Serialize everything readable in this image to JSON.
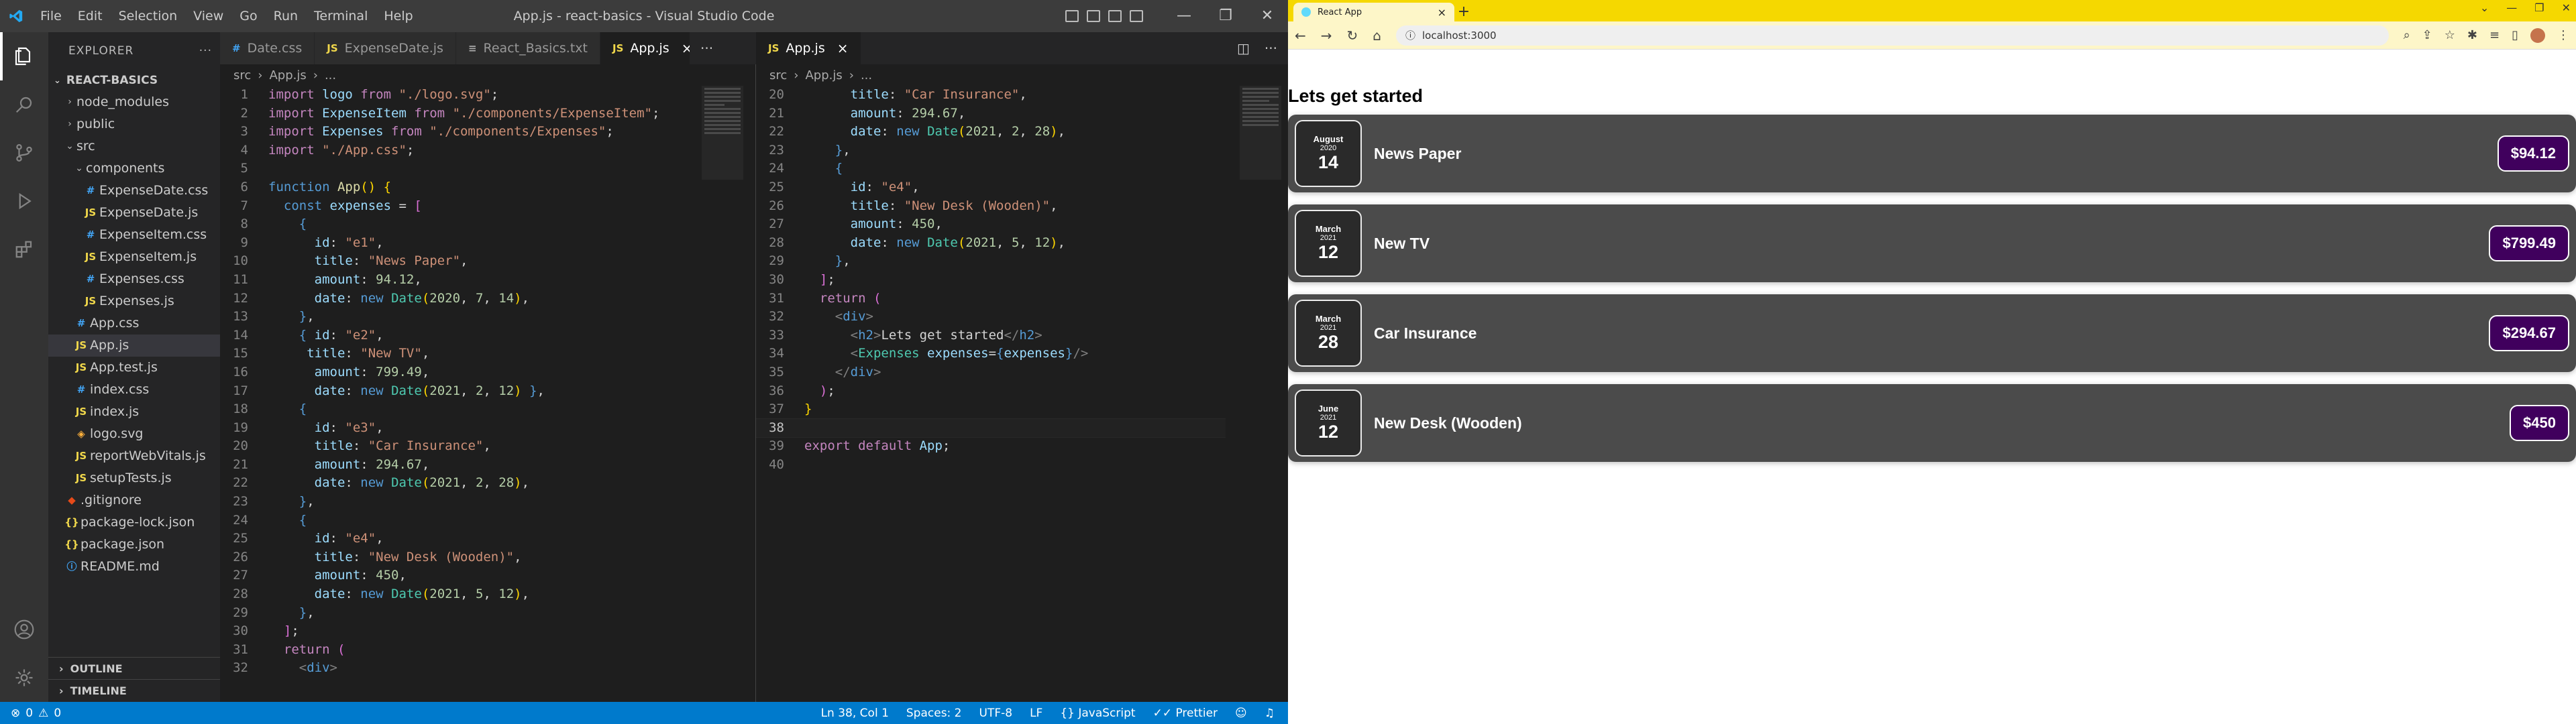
{
  "vscode": {
    "title": "App.js - react-basics - Visual Studio Code",
    "menu": [
      "File",
      "Edit",
      "Selection",
      "View",
      "Go",
      "Run",
      "Terminal",
      "Help"
    ],
    "sidebar": {
      "title": "EXPLORER",
      "project": "REACT-BASICS",
      "items": [
        {
          "label": "node_modules",
          "type": "folder",
          "depth": 1,
          "open": false
        },
        {
          "label": "public",
          "type": "folder",
          "depth": 1,
          "open": false
        },
        {
          "label": "src",
          "type": "folder",
          "depth": 1,
          "open": true
        },
        {
          "label": "components",
          "type": "folder",
          "depth": 2,
          "open": true
        },
        {
          "label": "ExpenseDate.css",
          "type": "css",
          "depth": 3
        },
        {
          "label": "ExpenseDate.js",
          "type": "js",
          "depth": 3
        },
        {
          "label": "ExpenseItem.css",
          "type": "css",
          "depth": 3
        },
        {
          "label": "ExpenseItem.js",
          "type": "js",
          "depth": 3
        },
        {
          "label": "Expenses.css",
          "type": "css",
          "depth": 3
        },
        {
          "label": "Expenses.js",
          "type": "js",
          "depth": 3
        },
        {
          "label": "App.css",
          "type": "css",
          "depth": 2
        },
        {
          "label": "App.js",
          "type": "js",
          "depth": 2,
          "selected": true
        },
        {
          "label": "App.test.js",
          "type": "js",
          "depth": 2
        },
        {
          "label": "index.css",
          "type": "css",
          "depth": 2
        },
        {
          "label": "index.js",
          "type": "js",
          "depth": 2
        },
        {
          "label": "logo.svg",
          "type": "svg",
          "depth": 2
        },
        {
          "label": "reportWebVitals.js",
          "type": "js",
          "depth": 2
        },
        {
          "label": "setupTests.js",
          "type": "js",
          "depth": 2
        },
        {
          "label": ".gitignore",
          "type": "git",
          "depth": 1
        },
        {
          "label": "package-lock.json",
          "type": "json",
          "depth": 1
        },
        {
          "label": "package.json",
          "type": "json",
          "depth": 1
        },
        {
          "label": "README.md",
          "type": "md",
          "depth": 1
        }
      ],
      "outline": "OUTLINE",
      "timeline": "TIMELINE"
    },
    "left_tabs": [
      {
        "label": "Date.css",
        "icon": "css",
        "active": false
      },
      {
        "label": "ExpenseDate.js",
        "icon": "js",
        "active": false
      },
      {
        "label": "React_Basics.txt",
        "icon": "txt",
        "active": false
      },
      {
        "label": "App.js",
        "icon": "js",
        "active": true
      }
    ],
    "right_tabs": [
      {
        "label": "App.js",
        "icon": "js",
        "active": true
      }
    ],
    "breadcrumb": [
      "src",
      "App.js",
      "..."
    ],
    "left_start_line": 1,
    "right_start_line": 20,
    "current_line": 38,
    "code": [
      [
        [
          "k",
          "import "
        ],
        [
          "t",
          "logo "
        ],
        [
          "k",
          "from "
        ],
        [
          "s",
          "\"./logo.svg\""
        ],
        [
          "p",
          ";"
        ]
      ],
      [
        [
          "k",
          "import "
        ],
        [
          "t",
          "ExpenseItem "
        ],
        [
          "k",
          "from "
        ],
        [
          "s",
          "\"./components/ExpenseItem\""
        ],
        [
          "p",
          ";"
        ]
      ],
      [
        [
          "k",
          "import "
        ],
        [
          "t",
          "Expenses "
        ],
        [
          "k",
          "from "
        ],
        [
          "s",
          "\"./components/Expenses\""
        ],
        [
          "p",
          ";"
        ]
      ],
      [
        [
          "k",
          "import "
        ],
        [
          "s",
          "\"./App.css\""
        ],
        [
          "p",
          ";"
        ]
      ],
      [],
      [
        [
          "b",
          "function "
        ],
        [
          "f",
          "App"
        ],
        [
          "y",
          "() {"
        ]
      ],
      [
        [
          "p",
          "  "
        ],
        [
          "b",
          "const "
        ],
        [
          "t",
          "expenses "
        ],
        [
          "p",
          "= "
        ],
        [
          "m",
          "["
        ]
      ],
      [
        [
          "p",
          "    "
        ],
        [
          "b",
          "{"
        ]
      ],
      [
        [
          "p",
          "      "
        ],
        [
          "t",
          "id"
        ],
        [
          "p",
          ": "
        ],
        [
          "s",
          "\"e1\""
        ],
        [
          "p",
          ","
        ]
      ],
      [
        [
          "p",
          "      "
        ],
        [
          "t",
          "title"
        ],
        [
          "p",
          ": "
        ],
        [
          "s",
          "\"News Paper\""
        ],
        [
          "p",
          ","
        ]
      ],
      [
        [
          "p",
          "      "
        ],
        [
          "t",
          "amount"
        ],
        [
          "p",
          ": "
        ],
        [
          "n",
          "94.12"
        ],
        [
          "p",
          ","
        ]
      ],
      [
        [
          "p",
          "      "
        ],
        [
          "t",
          "date"
        ],
        [
          "p",
          ": "
        ],
        [
          "b",
          "new "
        ],
        [
          "c",
          "Date"
        ],
        [
          "y",
          "("
        ],
        [
          "n",
          "2020"
        ],
        [
          "p",
          ", "
        ],
        [
          "n",
          "7"
        ],
        [
          "p",
          ", "
        ],
        [
          "n",
          "14"
        ],
        [
          "y",
          ")"
        ],
        [
          "p",
          ","
        ]
      ],
      [
        [
          "p",
          "    "
        ],
        [
          "b",
          "}"
        ],
        [
          "p",
          ","
        ]
      ],
      [
        [
          "p",
          "    "
        ],
        [
          "b",
          "{ "
        ],
        [
          "t",
          "id"
        ],
        [
          "p",
          ": "
        ],
        [
          "s",
          "\"e2\""
        ],
        [
          "p",
          ","
        ]
      ],
      [
        [
          "p",
          "     "
        ],
        [
          "t",
          "title"
        ],
        [
          "p",
          ": "
        ],
        [
          "s",
          "\"New TV\""
        ],
        [
          "p",
          ","
        ]
      ],
      [
        [
          "p",
          "      "
        ],
        [
          "t",
          "amount"
        ],
        [
          "p",
          ": "
        ],
        [
          "n",
          "799.49"
        ],
        [
          "p",
          ","
        ]
      ],
      [
        [
          "p",
          "      "
        ],
        [
          "t",
          "date"
        ],
        [
          "p",
          ": "
        ],
        [
          "b",
          "new "
        ],
        [
          "c",
          "Date"
        ],
        [
          "y",
          "("
        ],
        [
          "n",
          "2021"
        ],
        [
          "p",
          ", "
        ],
        [
          "n",
          "2"
        ],
        [
          "p",
          ", "
        ],
        [
          "n",
          "12"
        ],
        [
          "y",
          ")"
        ],
        [
          "b",
          " }"
        ],
        [
          "p",
          ","
        ]
      ],
      [
        [
          "p",
          "    "
        ],
        [
          "b",
          "{"
        ]
      ],
      [
        [
          "p",
          "      "
        ],
        [
          "t",
          "id"
        ],
        [
          "p",
          ": "
        ],
        [
          "s",
          "\"e3\""
        ],
        [
          "p",
          ","
        ]
      ],
      [
        [
          "p",
          "      "
        ],
        [
          "t",
          "title"
        ],
        [
          "p",
          ": "
        ],
        [
          "s",
          "\"Car Insurance\""
        ],
        [
          "p",
          ","
        ]
      ],
      [
        [
          "p",
          "      "
        ],
        [
          "t",
          "amount"
        ],
        [
          "p",
          ": "
        ],
        [
          "n",
          "294.67"
        ],
        [
          "p",
          ","
        ]
      ],
      [
        [
          "p",
          "      "
        ],
        [
          "t",
          "date"
        ],
        [
          "p",
          ": "
        ],
        [
          "b",
          "new "
        ],
        [
          "c",
          "Date"
        ],
        [
          "y",
          "("
        ],
        [
          "n",
          "2021"
        ],
        [
          "p",
          ", "
        ],
        [
          "n",
          "2"
        ],
        [
          "p",
          ", "
        ],
        [
          "n",
          "28"
        ],
        [
          "y",
          ")"
        ],
        [
          "p",
          ","
        ]
      ],
      [
        [
          "p",
          "    "
        ],
        [
          "b",
          "}"
        ],
        [
          "p",
          ","
        ]
      ],
      [
        [
          "p",
          "    "
        ],
        [
          "b",
          "{"
        ]
      ],
      [
        [
          "p",
          "      "
        ],
        [
          "t",
          "id"
        ],
        [
          "p",
          ": "
        ],
        [
          "s",
          "\"e4\""
        ],
        [
          "p",
          ","
        ]
      ],
      [
        [
          "p",
          "      "
        ],
        [
          "t",
          "title"
        ],
        [
          "p",
          ": "
        ],
        [
          "s",
          "\"New Desk (Wooden)\""
        ],
        [
          "p",
          ","
        ]
      ],
      [
        [
          "p",
          "      "
        ],
        [
          "t",
          "amount"
        ],
        [
          "p",
          ": "
        ],
        [
          "n",
          "450"
        ],
        [
          "p",
          ","
        ]
      ],
      [
        [
          "p",
          "      "
        ],
        [
          "t",
          "date"
        ],
        [
          "p",
          ": "
        ],
        [
          "b",
          "new "
        ],
        [
          "c",
          "Date"
        ],
        [
          "y",
          "("
        ],
        [
          "n",
          "2021"
        ],
        [
          "p",
          ", "
        ],
        [
          "n",
          "5"
        ],
        [
          "p",
          ", "
        ],
        [
          "n",
          "12"
        ],
        [
          "y",
          ")"
        ],
        [
          "p",
          ","
        ]
      ],
      [
        [
          "p",
          "    "
        ],
        [
          "b",
          "}"
        ],
        [
          "p",
          ","
        ]
      ],
      [
        [
          "p",
          "  "
        ],
        [
          "m",
          "]"
        ],
        [
          "p",
          ";"
        ]
      ],
      [
        [
          "p",
          "  "
        ],
        [
          "k",
          "return "
        ],
        [
          "m",
          "("
        ]
      ],
      [
        [
          "p",
          "    "
        ],
        [
          "g",
          "<"
        ],
        [
          "b",
          "div"
        ],
        [
          "g",
          ">"
        ]
      ],
      [
        [
          "p",
          "      "
        ],
        [
          "g",
          "<"
        ],
        [
          "b",
          "h2"
        ],
        [
          "g",
          ">"
        ],
        [
          "p",
          "Lets get started"
        ],
        [
          "g",
          "</"
        ],
        [
          "b",
          "h2"
        ],
        [
          "g",
          ">"
        ]
      ],
      [
        [
          "p",
          "      "
        ],
        [
          "g",
          "<"
        ],
        [
          "c",
          "Expenses "
        ],
        [
          "t",
          "expenses"
        ],
        [
          "p",
          "="
        ],
        [
          "b",
          "{"
        ],
        [
          "t",
          "expenses"
        ],
        [
          "b",
          "}"
        ],
        [
          "g",
          "/>"
        ]
      ],
      [
        [
          "p",
          "    "
        ],
        [
          "g",
          "</"
        ],
        [
          "b",
          "div"
        ],
        [
          "g",
          ">"
        ]
      ],
      [
        [
          "p",
          "  "
        ],
        [
          "m",
          ")"
        ],
        [
          "p",
          ";"
        ]
      ],
      [
        [
          "y",
          "}"
        ]
      ],
      [],
      [
        [
          "k",
          "export "
        ],
        [
          "k",
          "default "
        ],
        [
          "t",
          "App"
        ],
        [
          "p",
          ";"
        ]
      ],
      []
    ],
    "status": {
      "errors": "0",
      "warnings": "0",
      "position": "Ln 38, Col 1",
      "spaces": "Spaces: 2",
      "encoding": "UTF-8",
      "eol": "LF",
      "language": "JavaScript",
      "formatter": "Prettier"
    }
  },
  "browser": {
    "tab_title": "React App",
    "url": "localhost:3000",
    "heading": "Lets get started",
    "expenses": [
      {
        "month": "August",
        "year": "2020",
        "day": "14",
        "title": "News Paper",
        "price": "$94.12"
      },
      {
        "month": "March",
        "year": "2021",
        "day": "12",
        "title": "New TV",
        "price": "$799.49"
      },
      {
        "month": "March",
        "year": "2021",
        "day": "28",
        "title": "Car Insurance",
        "price": "$294.67"
      },
      {
        "month": "June",
        "year": "2021",
        "day": "12",
        "title": "New Desk (Wooden)",
        "price": "$450"
      }
    ]
  },
  "colors": {
    "accent": "#007acc",
    "card": "#4b4b4b",
    "price_bg": "#40005d",
    "chrome": "#f5d800"
  }
}
